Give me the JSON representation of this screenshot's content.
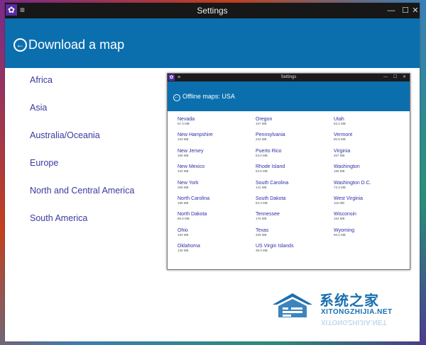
{
  "window": {
    "title": "Settings",
    "minimize": "—",
    "maximize": "☐",
    "close": "✕"
  },
  "header": {
    "back": "←",
    "title": "Download a map"
  },
  "regions": [
    "Africa",
    "Asia",
    "Australia/Oceania",
    "Europe",
    "North and Central America",
    "South America"
  ],
  "inset": {
    "title": "Settings",
    "header_title": "Offline maps: USA",
    "columns": [
      [
        {
          "name": "Nevada",
          "size": "67.3 MB"
        },
        {
          "name": "New Hampshire",
          "size": "103 MB"
        },
        {
          "name": "New Jersey",
          "size": "186 MB"
        },
        {
          "name": "New Mexico",
          "size": "102 MB"
        },
        {
          "name": "New York",
          "size": "268 MB"
        },
        {
          "name": "North Carolina",
          "size": "186 MB"
        },
        {
          "name": "North Dakota",
          "size": "85.9 MB"
        },
        {
          "name": "Ohio",
          "size": "183 MB"
        },
        {
          "name": "Oklahoma",
          "size": "136 MB"
        }
      ],
      [
        {
          "name": "Oregon",
          "size": "107 MB"
        },
        {
          "name": "Pennsylvania",
          "size": "224 MB"
        },
        {
          "name": "Puerto Rico",
          "size": "53.0 MB"
        },
        {
          "name": "Rhode Island",
          "size": "63.6 MB"
        },
        {
          "name": "South Carolina",
          "size": "141 MB"
        },
        {
          "name": "South Dakota",
          "size": "84.3 MB"
        },
        {
          "name": "Tennessee",
          "size": "176 MB"
        },
        {
          "name": "Texas",
          "size": "329 MB"
        },
        {
          "name": "US Virgin Islands",
          "size": "39.0 MB"
        }
      ],
      [
        {
          "name": "Utah",
          "size": "83.2 MB"
        },
        {
          "name": "Vermont",
          "size": "90.9 MB"
        },
        {
          "name": "Virginia",
          "size": "207 MB"
        },
        {
          "name": "Washington",
          "size": "159 MB"
        },
        {
          "name": "Washington D.C.",
          "size": "73.3 MB"
        },
        {
          "name": "West Virginia",
          "size": "115 MB"
        },
        {
          "name": "Wisconsin",
          "size": "164 MB"
        },
        {
          "name": "Wyoming",
          "size": "66.2 MB"
        }
      ]
    ]
  },
  "watermark": {
    "chinese": "系统之家",
    "url": "XITONGZHIJIA.NET"
  },
  "colors": {
    "accent": "#0b6fae",
    "titlebar": "#171717",
    "link": "#3a3aa0"
  }
}
